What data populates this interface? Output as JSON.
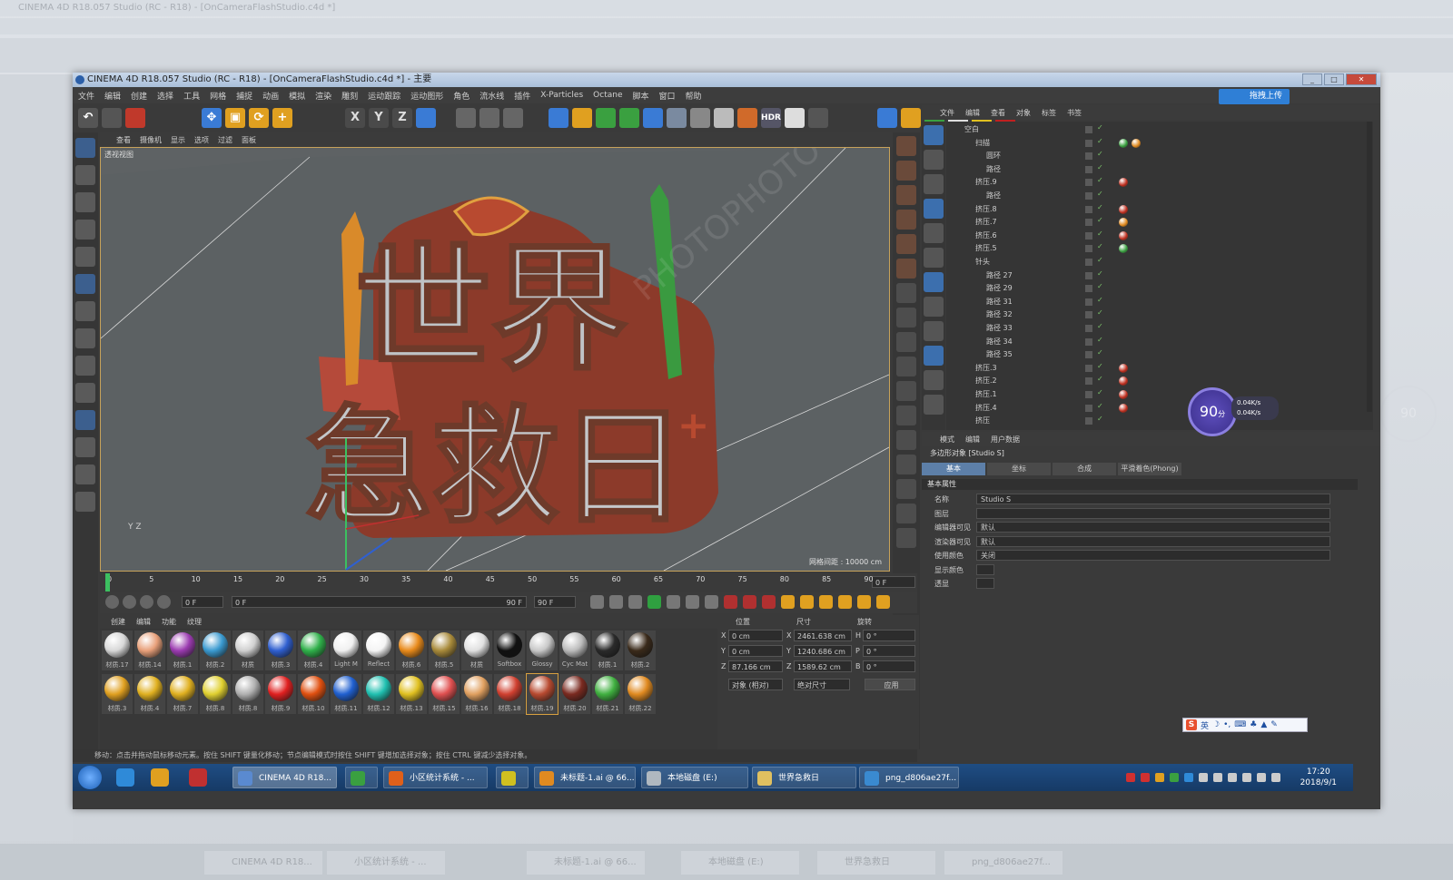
{
  "background": {
    "title": "CINEMA 4D R18.057 Studio (RC - R18) - [OnCameraFlashStudio.c4d *]",
    "score": "90",
    "taskbar": [
      "CINEMA 4D R18...",
      "小区统计系统 - ...",
      "未标题-1.ai @ 66...",
      "本地磁盘 (E:)",
      "世界急救日",
      "png_d806ae27f..."
    ]
  },
  "window": {
    "title": "CINEMA 4D R18.057 Studio (RC - R18) - [OnCameraFlashStudio.c4d *] - 主要",
    "buttons": [
      "_",
      "□",
      "✕"
    ],
    "menu": [
      "文件",
      "编辑",
      "创建",
      "选择",
      "工具",
      "网格",
      "捕捉",
      "动画",
      "模拟",
      "渲染",
      "雕刻",
      "运动跟踪",
      "运动图形",
      "角色",
      "流水线",
      "插件",
      "X-Particles",
      "Octane",
      "脚本",
      "窗口",
      "帮助"
    ],
    "cloud_button": "拖拽上传",
    "toolbar_icons": [
      "undo-icon",
      "redo-icon",
      "live-select-icon",
      "move-icon",
      "scale-icon",
      "rotate-icon",
      "add-icon",
      "x-axis-icon",
      "y-axis-icon",
      "z-axis-icon",
      "coord-system-icon",
      "render-view-icon",
      "render-picture-icon",
      "render-settings-icon",
      "cube-icon",
      "pen-icon",
      "subdivision-icon",
      "cloner-icon",
      "deformer-icon",
      "floor-icon",
      "camera-icon",
      "light-icon",
      "record-icon",
      "hdr-icon",
      "sky-icon",
      "picture-viewer-icon",
      "octane-icon",
      "material-icon",
      "settings-icon",
      "sun-icon",
      "render-icon",
      "white-ball-icon"
    ],
    "hdr_label": "HDR"
  },
  "viewport": {
    "menu": [
      "查看",
      "摄像机",
      "显示",
      "选项",
      "过滤",
      "面板"
    ],
    "label": "透视视图",
    "grid_info": "网格间距 : 10000 cm",
    "title_line1": "世界",
    "title_line2": "急救日",
    "watermark": "PHOTOPHOTO"
  },
  "timeline": {
    "ticks": [
      "0",
      "5",
      "10",
      "15",
      "20",
      "25",
      "30",
      "35",
      "40",
      "45",
      "50",
      "55",
      "60",
      "65",
      "70",
      "75",
      "80",
      "85",
      "90"
    ],
    "end_field": "0 F",
    "current_frame": "0 F",
    "start_field": "0 F",
    "range_end": "90 F",
    "max_frame": "90 F"
  },
  "materials": {
    "menu": [
      "创建",
      "编辑",
      "功能",
      "纹理"
    ],
    "items": [
      {
        "label": "材质.17",
        "color": "#d8d8d8"
      },
      {
        "label": "材质.14",
        "color": "#e8a07a"
      },
      {
        "label": "材质.1",
        "color": "#9b3bb0"
      },
      {
        "label": "材质.2",
        "color": "#3a9ad0"
      },
      {
        "label": "材质",
        "color": "#d0d0d0"
      },
      {
        "label": "材质.3",
        "color": "#2f5fd0"
      },
      {
        "label": "材质.4",
        "color": "#2fb04a"
      },
      {
        "label": "Light M",
        "color": "#f0f0f0"
      },
      {
        "label": "Reflect",
        "color": "#f4f4f4"
      },
      {
        "label": "材质.6",
        "color": "#e88a1a"
      },
      {
        "label": "材质.5",
        "color": "#a88a3a"
      },
      {
        "label": "材质",
        "color": "#e0e0e0"
      },
      {
        "label": "Softbox",
        "color": "#111111"
      },
      {
        "label": "Glossy",
        "color": "#c8c8c8"
      },
      {
        "label": "Cyc Mat",
        "color": "#bcbcbc"
      },
      {
        "label": "材质.1",
        "color": "#2a2a2a"
      },
      {
        "label": "材质.2",
        "color": "#3a2a1a"
      },
      {
        "label": "材质.3",
        "color": "#e0a020"
      },
      {
        "label": "材质.4",
        "color": "#e0b020"
      },
      {
        "label": "材质.7",
        "color": "#e0b020"
      },
      {
        "label": "材质.8",
        "color": "#e0d030"
      },
      {
        "label": "材质.8",
        "color": "#b0b0b0"
      },
      {
        "label": "材质.9",
        "color": "#e02020"
      },
      {
        "label": "材质.10",
        "color": "#e05010"
      },
      {
        "label": "材质.11",
        "color": "#2060d0"
      },
      {
        "label": "材质.12",
        "color": "#20c0b0"
      },
      {
        "label": "材质.13",
        "color": "#e0c020"
      },
      {
        "label": "材质.15",
        "color": "#e05050"
      },
      {
        "label": "材质.16",
        "color": "#e0a060"
      },
      {
        "label": "材质.18",
        "color": "#d04030"
      },
      {
        "label": "材质.19",
        "color": "#b84a30"
      },
      {
        "label": "材质.20",
        "color": "#7a2a20"
      },
      {
        "label": "材质.21",
        "color": "#40b040"
      },
      {
        "label": "材质.22",
        "color": "#e08a20"
      }
    ]
  },
  "coordinates": {
    "headers": [
      "位置",
      "尺寸",
      "旋转"
    ],
    "rows": [
      {
        "axis": "X",
        "pos": "0 cm",
        "size_axis": "X",
        "size": "2461.638 cm",
        "rot_axis": "H",
        "rot": "0 °"
      },
      {
        "axis": "Y",
        "pos": "0 cm",
        "size_axis": "Y",
        "size": "1240.686 cm",
        "rot_axis": "P",
        "rot": "0 °"
      },
      {
        "axis": "Z",
        "pos": "87.166 cm",
        "size_axis": "Z",
        "size": "1589.62 cm",
        "rot_axis": "B",
        "rot": "0 °"
      }
    ],
    "mode": "对象 (相对)",
    "size_mode": "绝对尺寸",
    "apply": "应用"
  },
  "status": "移动：点击并拖动鼠标移动元素。按住 SHIFT 键量化移动；节点编辑模式时按住 SHIFT 键增加选择对象；按住 CTRL 键减少选择对象。",
  "object_manager": {
    "menu": [
      "文件",
      "编辑",
      "查看",
      "对象",
      "标签",
      "书签"
    ],
    "rows": [
      {
        "name": "空白",
        "indent": 0,
        "tags": []
      },
      {
        "name": "扫描",
        "indent": 1,
        "tags": [
          "#3aa040",
          "#e08a20"
        ]
      },
      {
        "name": "圆环",
        "indent": 2,
        "tags": []
      },
      {
        "name": "路径",
        "indent": 2,
        "tags": []
      },
      {
        "name": "挤压.9",
        "indent": 1,
        "tags": [
          "#c03020"
        ]
      },
      {
        "name": "路径",
        "indent": 2,
        "tags": []
      },
      {
        "name": "挤压.8",
        "indent": 1,
        "tags": [
          "#c03020"
        ]
      },
      {
        "name": "挤压.7",
        "indent": 1,
        "tags": [
          "#e08a20"
        ]
      },
      {
        "name": "挤压.6",
        "indent": 1,
        "tags": [
          "#c03020"
        ]
      },
      {
        "name": "挤压.5",
        "indent": 1,
        "tags": [
          "#3aa040"
        ]
      },
      {
        "name": "针头",
        "indent": 1,
        "tags": []
      },
      {
        "name": "路径 27",
        "indent": 2,
        "tags": []
      },
      {
        "name": "路径 29",
        "indent": 2,
        "tags": []
      },
      {
        "name": "路径 31",
        "indent": 2,
        "tags": []
      },
      {
        "name": "路径 32",
        "indent": 2,
        "tags": []
      },
      {
        "name": "路径 33",
        "indent": 2,
        "tags": []
      },
      {
        "name": "路径 34",
        "indent": 2,
        "tags": []
      },
      {
        "name": "路径 35",
        "indent": 2,
        "tags": []
      },
      {
        "name": "挤压.3",
        "indent": 1,
        "tags": [
          "#c03020"
        ]
      },
      {
        "name": "挤压.2",
        "indent": 1,
        "tags": [
          "#c03020"
        ]
      },
      {
        "name": "挤压.1",
        "indent": 1,
        "tags": [
          "#c03020"
        ]
      },
      {
        "name": "挤压.4",
        "indent": 1,
        "tags": [
          "#c03020"
        ]
      },
      {
        "name": "挤压",
        "indent": 1,
        "tags": []
      }
    ]
  },
  "network": {
    "score": "90",
    "score_unit": "分",
    "up": "0.04K/s",
    "down": "0.04K/s"
  },
  "attributes": {
    "menu": [
      "模式",
      "编辑",
      "用户数据"
    ],
    "object": "多边形对象 [Studio S]",
    "tabs": [
      "基本",
      "坐标",
      "合成",
      "平滑着色(Phong)"
    ],
    "section": "基本属性",
    "rows": [
      {
        "label": "名称",
        "value": "Studio S"
      },
      {
        "label": "图层",
        "value": ""
      },
      {
        "label": "编辑器可见",
        "value": "默认"
      },
      {
        "label": "渲染器可见",
        "value": "默认"
      },
      {
        "label": "使用颜色",
        "value": "关闭"
      },
      {
        "label": "显示颜色",
        "value": ""
      },
      {
        "label": "透显",
        "value": ""
      }
    ]
  },
  "ime": {
    "lang": "英"
  },
  "taskbar": {
    "items": [
      {
        "label": "CINEMA 4D R18...",
        "color": "#5a8ad0"
      },
      {
        "label": "",
        "color": "#3aa040"
      },
      {
        "label": "小区统计系统 - ...",
        "color": "#e0601a"
      },
      {
        "label": "",
        "color": "#d0c020"
      },
      {
        "label": "未标题-1.ai @ 66...",
        "color": "#e08a20"
      },
      {
        "label": "本地磁盘 (E:)",
        "color": "#b0b8c0"
      },
      {
        "label": "世界急救日",
        "color": "#e0c060"
      },
      {
        "label": "png_d806ae27f...",
        "color": "#3a8ad0"
      }
    ],
    "time": "17:20",
    "date": "2018/9/1"
  }
}
